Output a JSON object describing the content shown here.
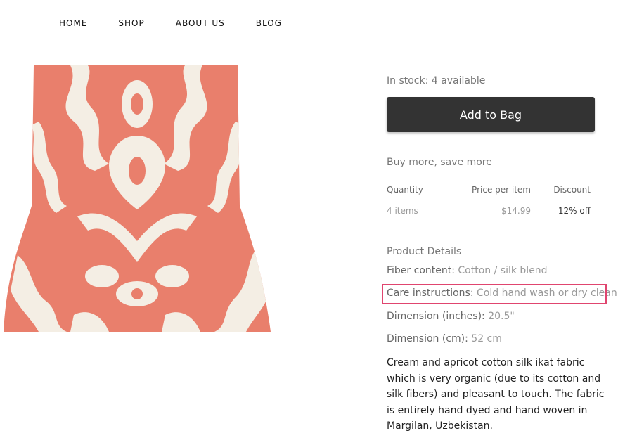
{
  "nav": {
    "items": [
      {
        "label": "HOME"
      },
      {
        "label": "SHOP"
      },
      {
        "label": "ABOUT US"
      },
      {
        "label": "BLOG"
      }
    ]
  },
  "product": {
    "image": {
      "colors": {
        "pattern": "#e97f6c",
        "ground": "#f4eee4"
      }
    },
    "stock": "In stock: 4 available",
    "add_to_bag": "Add to Bag",
    "buy_more_title": "Buy more, save more",
    "discount_table": {
      "headers": [
        "Quantity",
        "Price per item",
        "Discount"
      ],
      "rows": [
        {
          "quantity": "4 items",
          "price": "$14.99",
          "discount": "12% off"
        }
      ]
    },
    "details_title": "Product Details",
    "details": [
      {
        "label": "Fiber content:",
        "value": "Cotton / silk blend"
      },
      {
        "label": "Care instructions:",
        "value": "Cold hand wash or dry clean"
      },
      {
        "label": "Dimension (inches):",
        "value": "20.5\""
      },
      {
        "label": "Dimension (cm):",
        "value": "52 cm"
      }
    ],
    "description": "Cream and apricot cotton silk ikat fabric which is very organic (due to its cotton and silk fibers) and pleasant to touch. The fabric is entirely hand dyed and hand woven in Margilan, Uzbekistan."
  },
  "colors": {
    "button_bg": "#333333",
    "highlight": "#e0456f"
  }
}
